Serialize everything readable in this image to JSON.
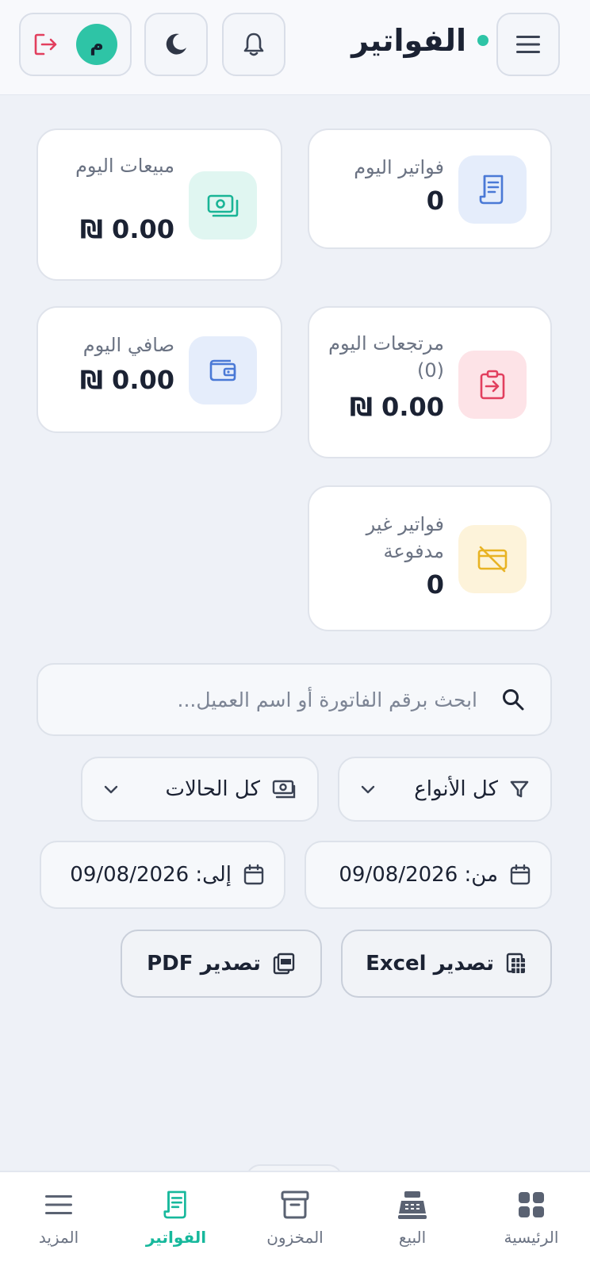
{
  "header": {
    "title": "الفواتير",
    "avatar_letter": "م",
    "accent_color": "#2ec4a6",
    "icons": [
      "menu-icon",
      "bell-icon",
      "moon-icon",
      "logout-icon"
    ]
  },
  "stats": {
    "today_invoices": {
      "label": "فواتير اليوم",
      "value": "0"
    },
    "today_sales": {
      "label": "مبيعات اليوم",
      "value": "0.00 ₪"
    },
    "today_returns": {
      "label": "مرتجعات اليوم (0)",
      "value": "0.00 ₪"
    },
    "today_net": {
      "label": "صافي اليوم",
      "value": "0.00 ₪"
    },
    "unpaid_invoices": {
      "label": "فواتير غير مدفوعة",
      "value": "0"
    }
  },
  "search": {
    "placeholder": "ابحث برقم الفاتورة أو اسم العميل..."
  },
  "filters": {
    "type": "كل الأنواع",
    "status": "كل الحالات",
    "from_date": "من: 09/08/2026",
    "to_date": "إلى: 09/08/2026"
  },
  "actions": {
    "export_excel": "تصدير Excel",
    "export_pdf": "تصدير PDF"
  },
  "nav": {
    "home": "الرئيسية",
    "sales": "البيع",
    "inventory": "المخزون",
    "invoices": "الفواتير",
    "more": "المزيد"
  }
}
